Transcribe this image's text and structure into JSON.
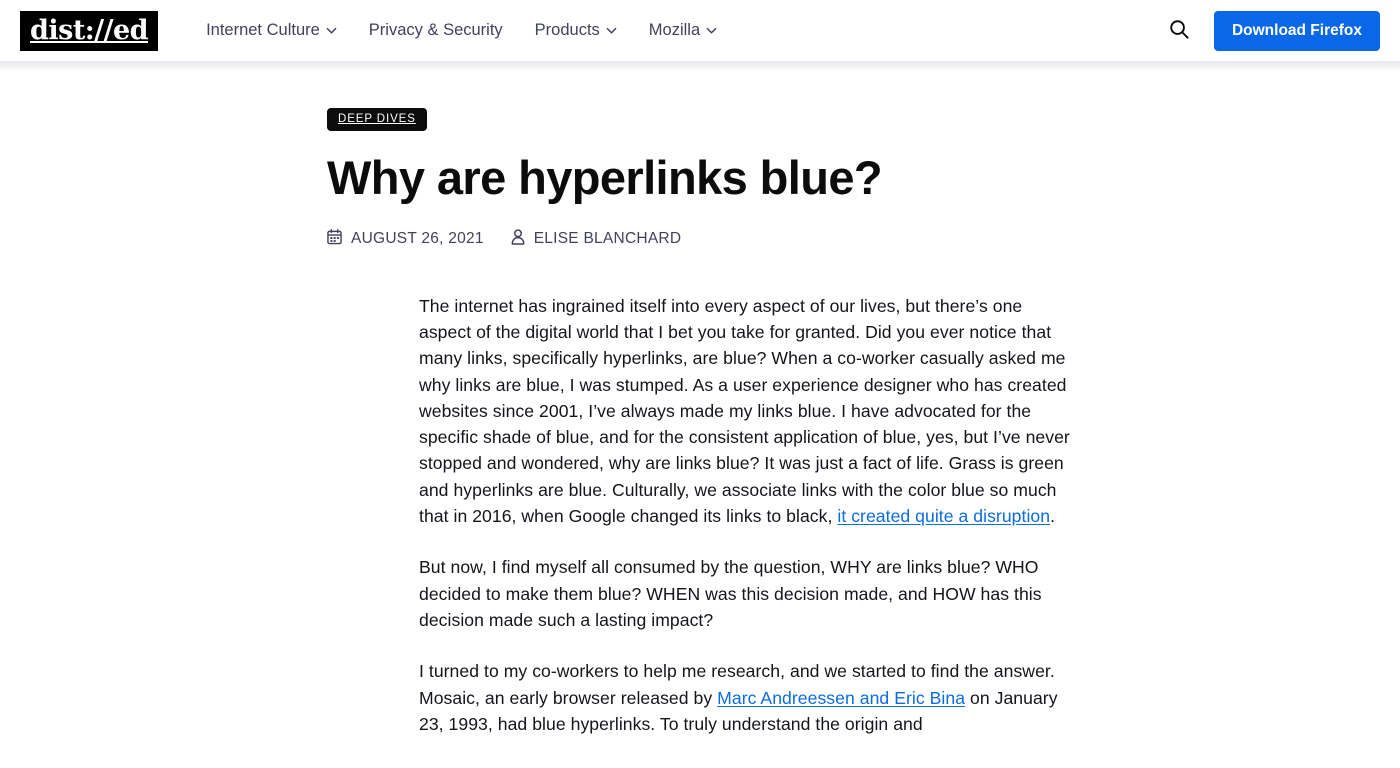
{
  "header": {
    "logo_text": "dist://ed",
    "nav": [
      {
        "label": "Internet Culture",
        "has_dropdown": true
      },
      {
        "label": "Privacy & Security",
        "has_dropdown": false
      },
      {
        "label": "Products",
        "has_dropdown": true
      },
      {
        "label": "Mozilla",
        "has_dropdown": true
      }
    ],
    "search_icon": "search-icon",
    "download_label": "Download Firefox",
    "download_button_color": "#0a68e8"
  },
  "article": {
    "category_badge": "DEEP DIVES",
    "title": "Why are hyperlinks blue?",
    "date": "AUGUST 26, 2021",
    "date_icon": "calendar-icon",
    "author": "ELISE BLANCHARD",
    "author_icon": "person-icon",
    "link_color": "#0a6cde",
    "paragraphs": [
      {
        "parts": [
          {
            "type": "text",
            "text": "The internet has ingrained itself into every aspect of our lives, but there’s one aspect of the digital world that I bet you take for granted. Did you ever notice that many links, specifically hyperlinks, are blue? When a co-worker casually asked me why links are blue, I was stumped. As a user experience designer who has created websites since 2001, I’ve always made my links blue. I have advocated for the specific shade of blue, and for the consistent application of blue, yes, but I’ve never stopped and wondered, why are links blue? It was just a fact of life. Grass is green and hyperlinks are blue. Culturally, we associate links with the color blue so much that in 2016, when Google changed its links to black, "
          },
          {
            "type": "link",
            "text": "it created quite a disruption"
          },
          {
            "type": "text",
            "text": "."
          }
        ]
      },
      {
        "parts": [
          {
            "type": "text",
            "text": "But now, I find myself all consumed by the question, WHY are links blue? WHO decided to make them blue? WHEN was this decision made, and HOW has this decision made such a lasting impact?"
          }
        ]
      },
      {
        "parts": [
          {
            "type": "text",
            "text": "I turned to my co-workers to help me research, and we started to find the answer. Mosaic, an early browser released by "
          },
          {
            "type": "link",
            "text": "Marc Andreessen and Eric Bina"
          },
          {
            "type": "text",
            "text": " on January 23, 1993, had blue hyperlinks. To truly understand the origin and"
          }
        ]
      }
    ]
  }
}
